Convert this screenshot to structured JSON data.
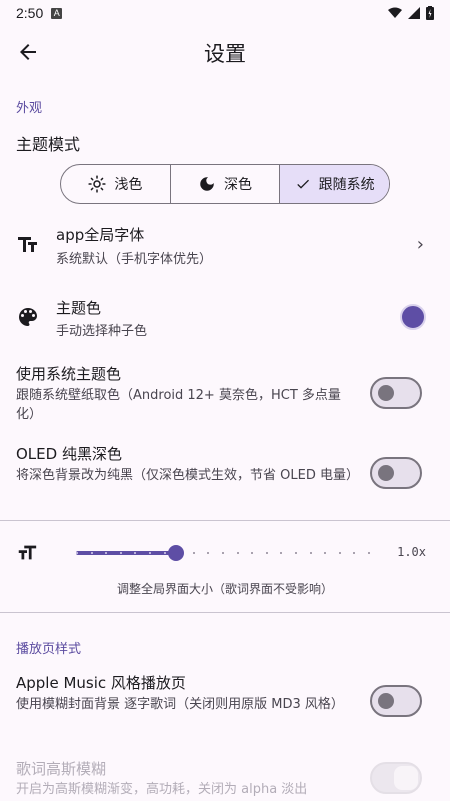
{
  "status": {
    "time": "2:50",
    "badge": "A"
  },
  "header": {
    "title": "设置"
  },
  "appearance": {
    "section": "外观",
    "theme_mode_label": "主题模式",
    "segments": [
      {
        "label": "浅色",
        "icon": "sun-icon",
        "selected": false
      },
      {
        "label": "深色",
        "icon": "moon-icon",
        "selected": false
      },
      {
        "label": "跟随系统",
        "icon": "check-icon",
        "selected": true
      }
    ],
    "font": {
      "title": "app全局字体",
      "subtitle": "系统默认（手机字体优先）",
      "icon": "text-size-icon"
    },
    "theme_color": {
      "title": "主题色",
      "subtitle": "手动选择种子色",
      "icon": "palette-icon",
      "color": "#5e4ea5"
    },
    "system_theme": {
      "title": "使用系统主题色",
      "subtitle": "跟随系统壁纸取色（Android 12+ 莫奈色，HCT 多点量化）",
      "on": false
    },
    "oled": {
      "title": "OLED 纯黑深色",
      "subtitle": "将深色背景改为纯黑（仅深色模式生效，节省 OLED 电量）",
      "on": false
    },
    "scale": {
      "value_label": "1.0x",
      "fraction": 0.34,
      "caption": "调整全局界面大小（歌词界面不受影响）"
    }
  },
  "player": {
    "section": "播放页样式",
    "apple_music": {
      "title": "Apple Music 风格播放页",
      "subtitle": "使用模糊封面背景 逐字歌词（关闭则用原版 MD3 风格）",
      "on": false
    },
    "blur": {
      "title": "歌词高斯模糊",
      "subtitle": "开启为高斯模糊渐变，高功耗，关闭为 alpha 淡出",
      "on": true,
      "disabled": true
    }
  },
  "colors": {
    "accent": "#5e4ea5",
    "section": "#5b4ba0",
    "background": "#fdf8fd"
  }
}
